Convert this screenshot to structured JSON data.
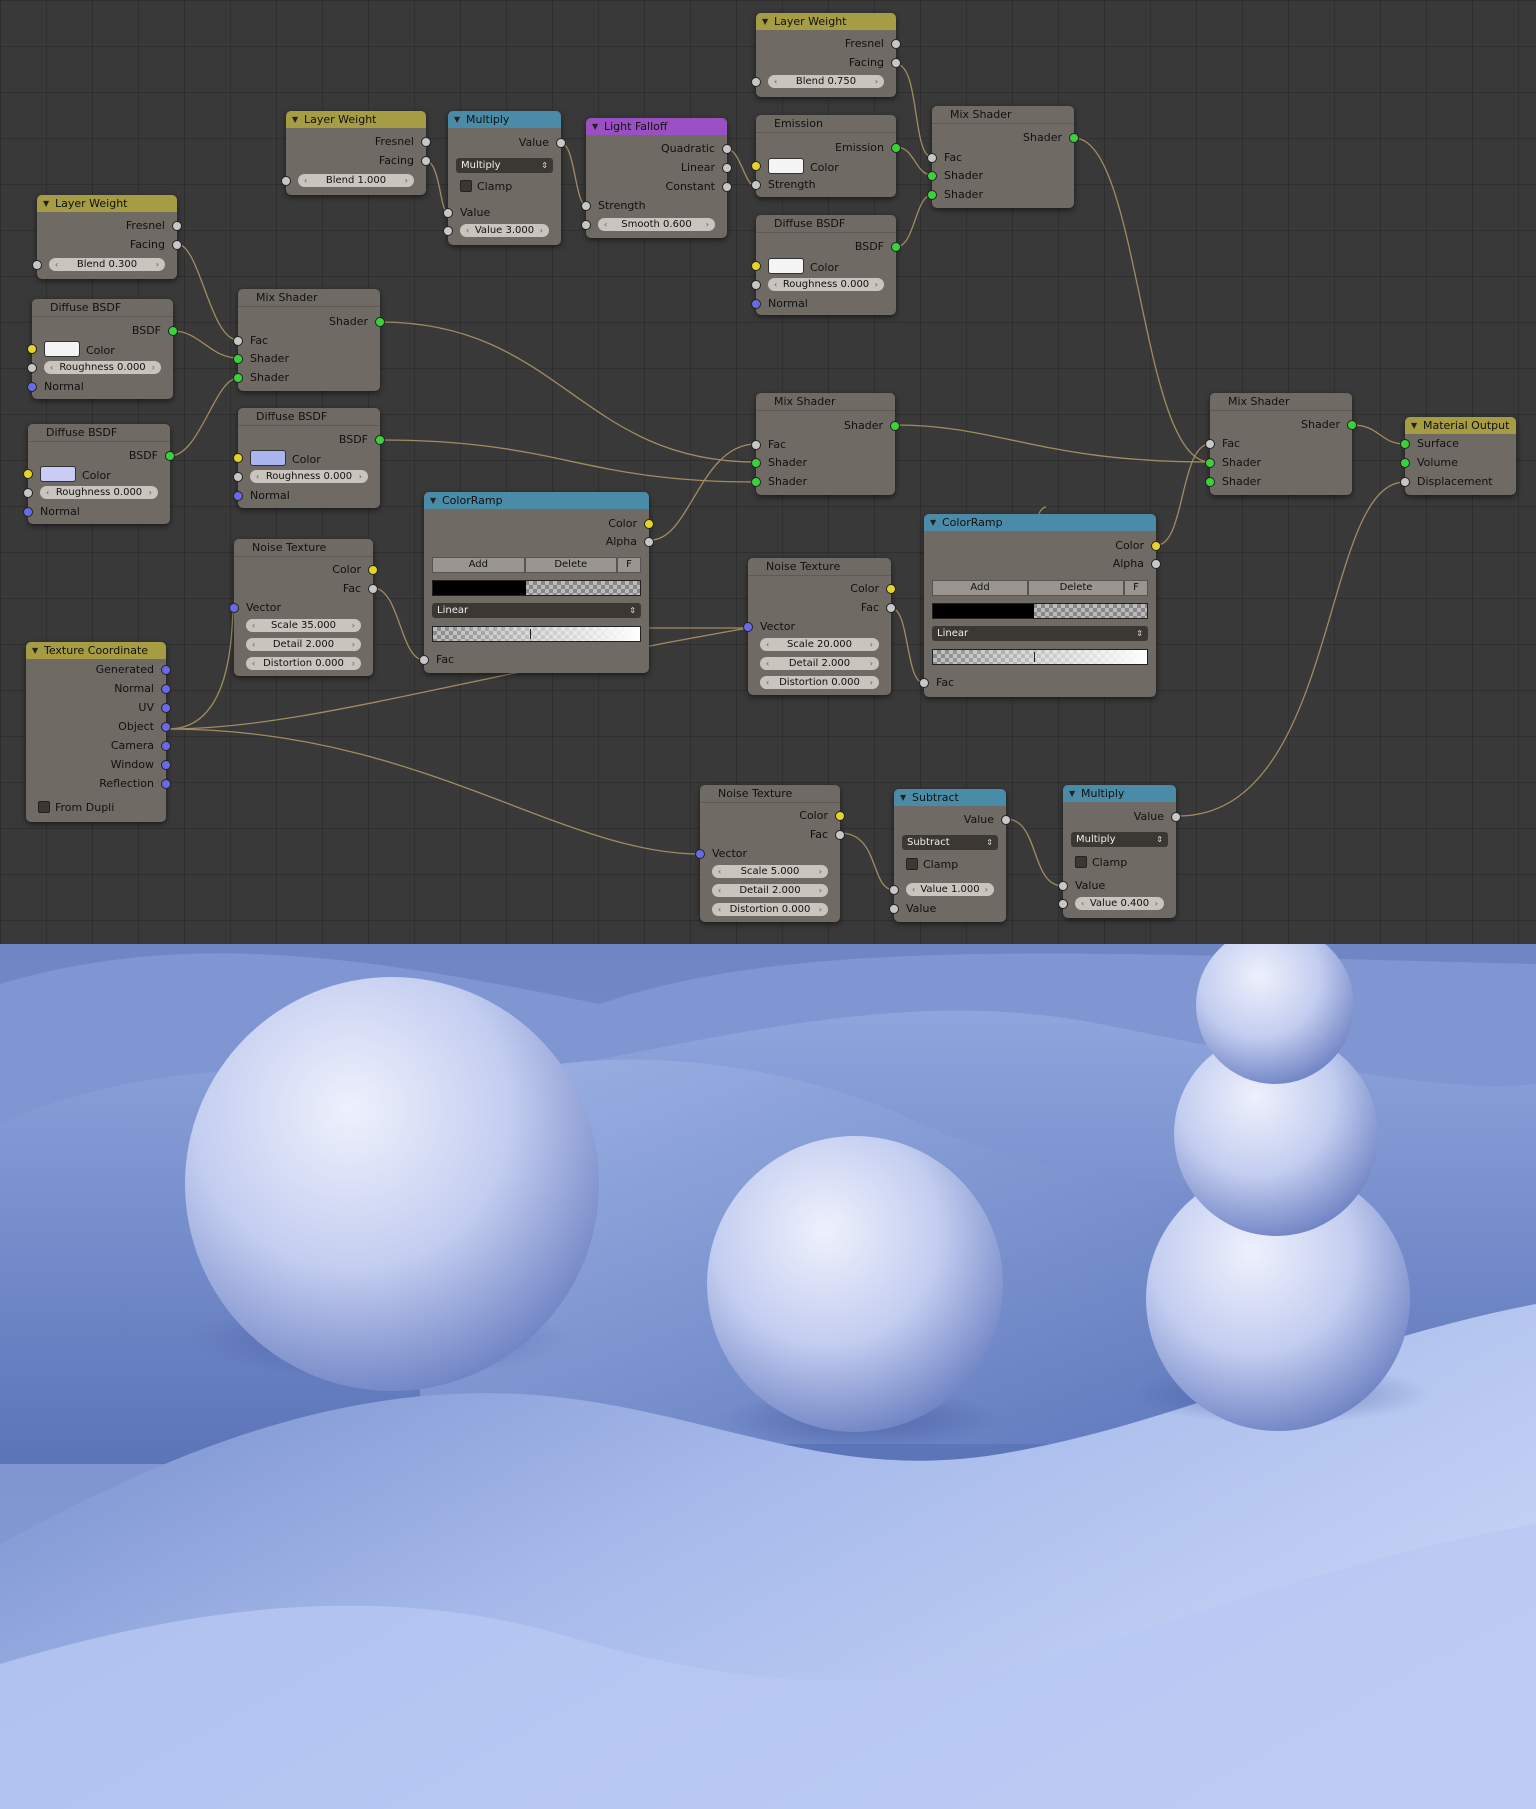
{
  "nodes": {
    "lw1": {
      "title": "Layer Weight",
      "fresnel": "Fresnel",
      "facing": "Facing",
      "blend": "Blend 1.000"
    },
    "lw2": {
      "title": "Layer Weight",
      "fresnel": "Fresnel",
      "facing": "Facing",
      "blend": "Blend 0.300"
    },
    "lw3": {
      "title": "Layer Weight",
      "fresnel": "Fresnel",
      "facing": "Facing",
      "blend": "Blend 0.750"
    },
    "mult1": {
      "title": "Multiply",
      "out": "Value",
      "op": "Multiply",
      "clamp": "Clamp",
      "in": "Value",
      "val": "Value 3.000"
    },
    "falloff": {
      "title": "Light Falloff",
      "quad": "Quadratic",
      "lin": "Linear",
      "const": "Constant",
      "strength": "Strength",
      "smooth": "Smooth 0.600"
    },
    "emission": {
      "title": "Emission",
      "out": "Emission",
      "color": "Color",
      "strength": "Strength",
      "swatch": "#f4f4f4"
    },
    "diff_top": {
      "title": "Diffuse BSDF",
      "out": "BSDF",
      "color": "Color",
      "rough": "Roughness 0.000",
      "normal": "Normal",
      "swatch": "#f4f4f4"
    },
    "mix_top": {
      "title": "Mix Shader",
      "out": "Shader",
      "fac": "Fac",
      "s1": "Shader",
      "s2": "Shader"
    },
    "diff_l1": {
      "title": "Diffuse BSDF",
      "out": "BSDF",
      "color": "Color",
      "rough": "Roughness 0.000",
      "normal": "Normal",
      "swatch": "#f4f4f4"
    },
    "diff_l2": {
      "title": "Diffuse BSDF",
      "out": "BSDF",
      "color": "Color",
      "rough": "Roughness 0.000",
      "normal": "Normal",
      "swatch": "#c9cdf6"
    },
    "mix_left": {
      "title": "Mix Shader",
      "out": "Shader",
      "fac": "Fac",
      "s1": "Shader",
      "s2": "Shader"
    },
    "diff_mid": {
      "title": "Diffuse BSDF",
      "out": "BSDF",
      "color": "Color",
      "rough": "Roughness 0.000",
      "normal": "Normal",
      "swatch": "#a9b6f0"
    },
    "mix_mid": {
      "title": "Mix Shader",
      "out": "Shader",
      "fac": "Fac",
      "s1": "Shader",
      "s2": "Shader"
    },
    "mix_right": {
      "title": "Mix Shader",
      "out": "Shader",
      "fac": "Fac",
      "s1": "Shader",
      "s2": "Shader"
    },
    "output": {
      "title": "Material Output",
      "surface": "Surface",
      "volume": "Volume",
      "disp": "Displacement"
    },
    "noise1": {
      "title": "Noise Texture",
      "color": "Color",
      "fac": "Fac",
      "vector": "Vector",
      "scale": "Scale 35.000",
      "detail": "Detail 2.000",
      "dist": "Distortion 0.000"
    },
    "noise2": {
      "title": "Noise Texture",
      "color": "Color",
      "fac": "Fac",
      "vector": "Vector",
      "scale": "Scale 20.000",
      "detail": "Detail 2.000",
      "dist": "Distortion 0.000"
    },
    "noise3": {
      "title": "Noise Texture",
      "color": "Color",
      "fac": "Fac",
      "vector": "Vector",
      "scale": "Scale 5.000",
      "detail": "Detail 2.000",
      "dist": "Distortion 0.000"
    },
    "ramp1": {
      "title": "ColorRamp",
      "color": "Color",
      "alpha": "Alpha",
      "add": "Add",
      "del": "Delete",
      "f": "F",
      "interp": "Linear",
      "fac": "Fac"
    },
    "ramp2": {
      "title": "ColorRamp",
      "color": "Color",
      "alpha": "Alpha",
      "add": "Add",
      "del": "Delete",
      "f": "F",
      "interp": "Linear",
      "fac": "Fac"
    },
    "texco": {
      "title": "Texture Coordinate",
      "generated": "Generated",
      "normal": "Normal",
      "uv": "UV",
      "object": "Object",
      "camera": "Camera",
      "window": "Window",
      "reflection": "Reflection",
      "dupli": "From Dupli"
    },
    "subtract": {
      "title": "Subtract",
      "out": "Value",
      "op": "Subtract",
      "clamp": "Clamp",
      "val": "Value 1.000",
      "in": "Value"
    },
    "mult2": {
      "title": "Multiply",
      "out": "Value",
      "op": "Multiply",
      "clamp": "Clamp",
      "in": "Value",
      "val": "Value 0.400"
    }
  },
  "colors": {
    "wire": "#b49a6a",
    "accent_input": "#a59c43",
    "accent_converter": "#4a8ba8",
    "accent_falloff": "#9a4fc2"
  }
}
